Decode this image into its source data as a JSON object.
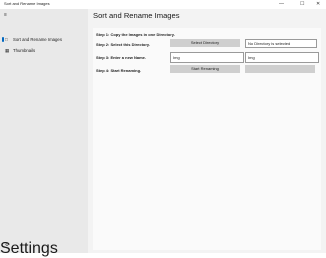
{
  "app": {
    "title": "Sort and Rename Images"
  },
  "window_controls": {
    "minimize": "—",
    "maximize": "☐",
    "close": "✕"
  },
  "sidebar": {
    "menu_icon": "hamburger-menu-icon",
    "items": [
      {
        "label": "Sort and Rename Images",
        "icon": "image-icon",
        "selected": true
      },
      {
        "label": "Thumbnails",
        "icon": "thumbnails-icon",
        "selected": false
      }
    ],
    "settings_label": "Settings",
    "settings_icon": "gear-icon"
  },
  "main": {
    "title": "Sort and Rename Images",
    "steps": [
      {
        "label": "Step 1: Copy the Images in one Directory."
      },
      {
        "label": "Step 2: Select this Directory.",
        "button": "Select Directory",
        "status": "No Directory is selected"
      },
      {
        "label": "Step 3: Enter a new Name.",
        "input1_value": "Img",
        "input2_value": "Img"
      },
      {
        "label": "Step 4: Start Renaming.",
        "button": "Start Renaming",
        "status": ""
      }
    ]
  },
  "colors": {
    "accent": "#0067c0",
    "sidebar_bg": "#e9e9e9",
    "content_bg": "#f3f3f3"
  }
}
